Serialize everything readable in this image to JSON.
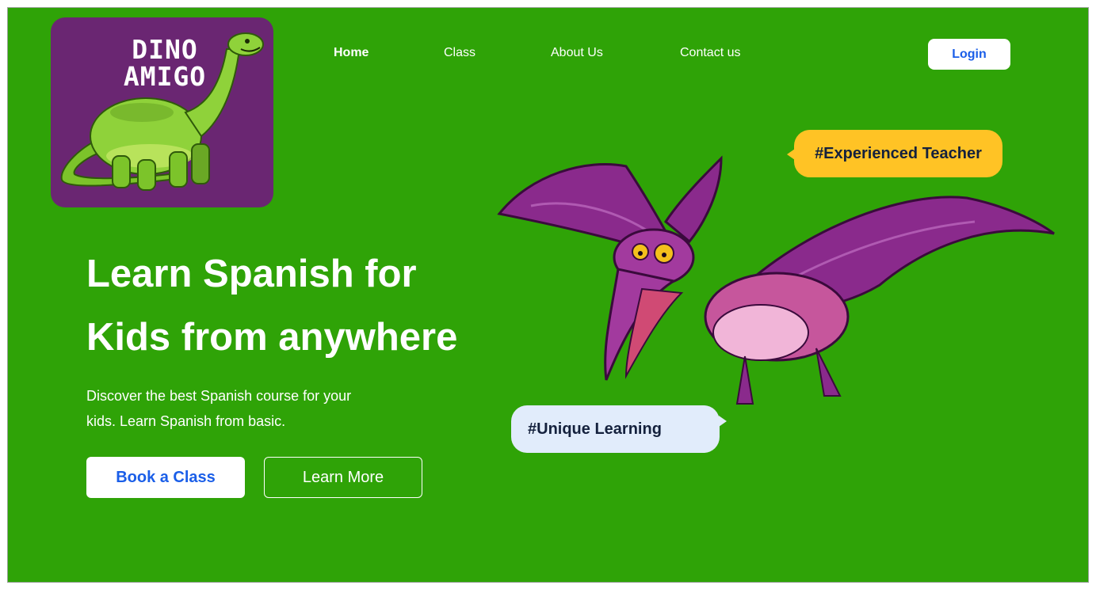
{
  "brand": {
    "logo_line1": "DINO",
    "logo_line2": "AMIGO",
    "logo_bg": "#6a2672"
  },
  "nav": {
    "items": [
      {
        "label": "Home",
        "active": true
      },
      {
        "label": "Class",
        "active": false
      },
      {
        "label": "About Us",
        "active": false
      },
      {
        "label": "Contact us",
        "active": false
      }
    ],
    "login_label": "Login"
  },
  "hero": {
    "title_line1": "Learn Spanish for",
    "title_line2": "Kids from anywhere",
    "subtitle_line1": "Discover the best Spanish course for your",
    "subtitle_line2": "kids. Learn Spanish from basic.",
    "primary_cta": "Book a Class",
    "secondary_cta": "Learn More"
  },
  "bubbles": {
    "teacher": "#Experienced Teacher",
    "unique": "#Unique Learning"
  },
  "colors": {
    "background": "#2fa307",
    "accent_blue": "#1a5ee8",
    "bubble_yellow": "#ffc325",
    "bubble_light_blue": "#e1ecfb",
    "dino_green": "#7cc42a",
    "ptero_purple": "#8a2a8c"
  },
  "icons": {
    "logo_illustration": "brontosaurus-icon",
    "hero_illustration": "pterodactyl-illustration"
  }
}
